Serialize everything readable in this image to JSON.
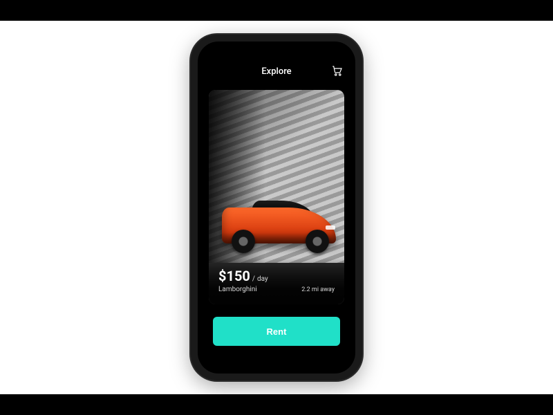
{
  "header": {
    "title": "Explore"
  },
  "card": {
    "price": "$150",
    "price_separator": "/",
    "price_unit": "day",
    "car_name": "Lamborghini",
    "distance": "2.2 mi away"
  },
  "actions": {
    "rent_label": "Rent"
  },
  "colors": {
    "accent": "#20e0c8",
    "car_body": "#e8470f"
  },
  "icons": {
    "cart": "cart-icon"
  }
}
